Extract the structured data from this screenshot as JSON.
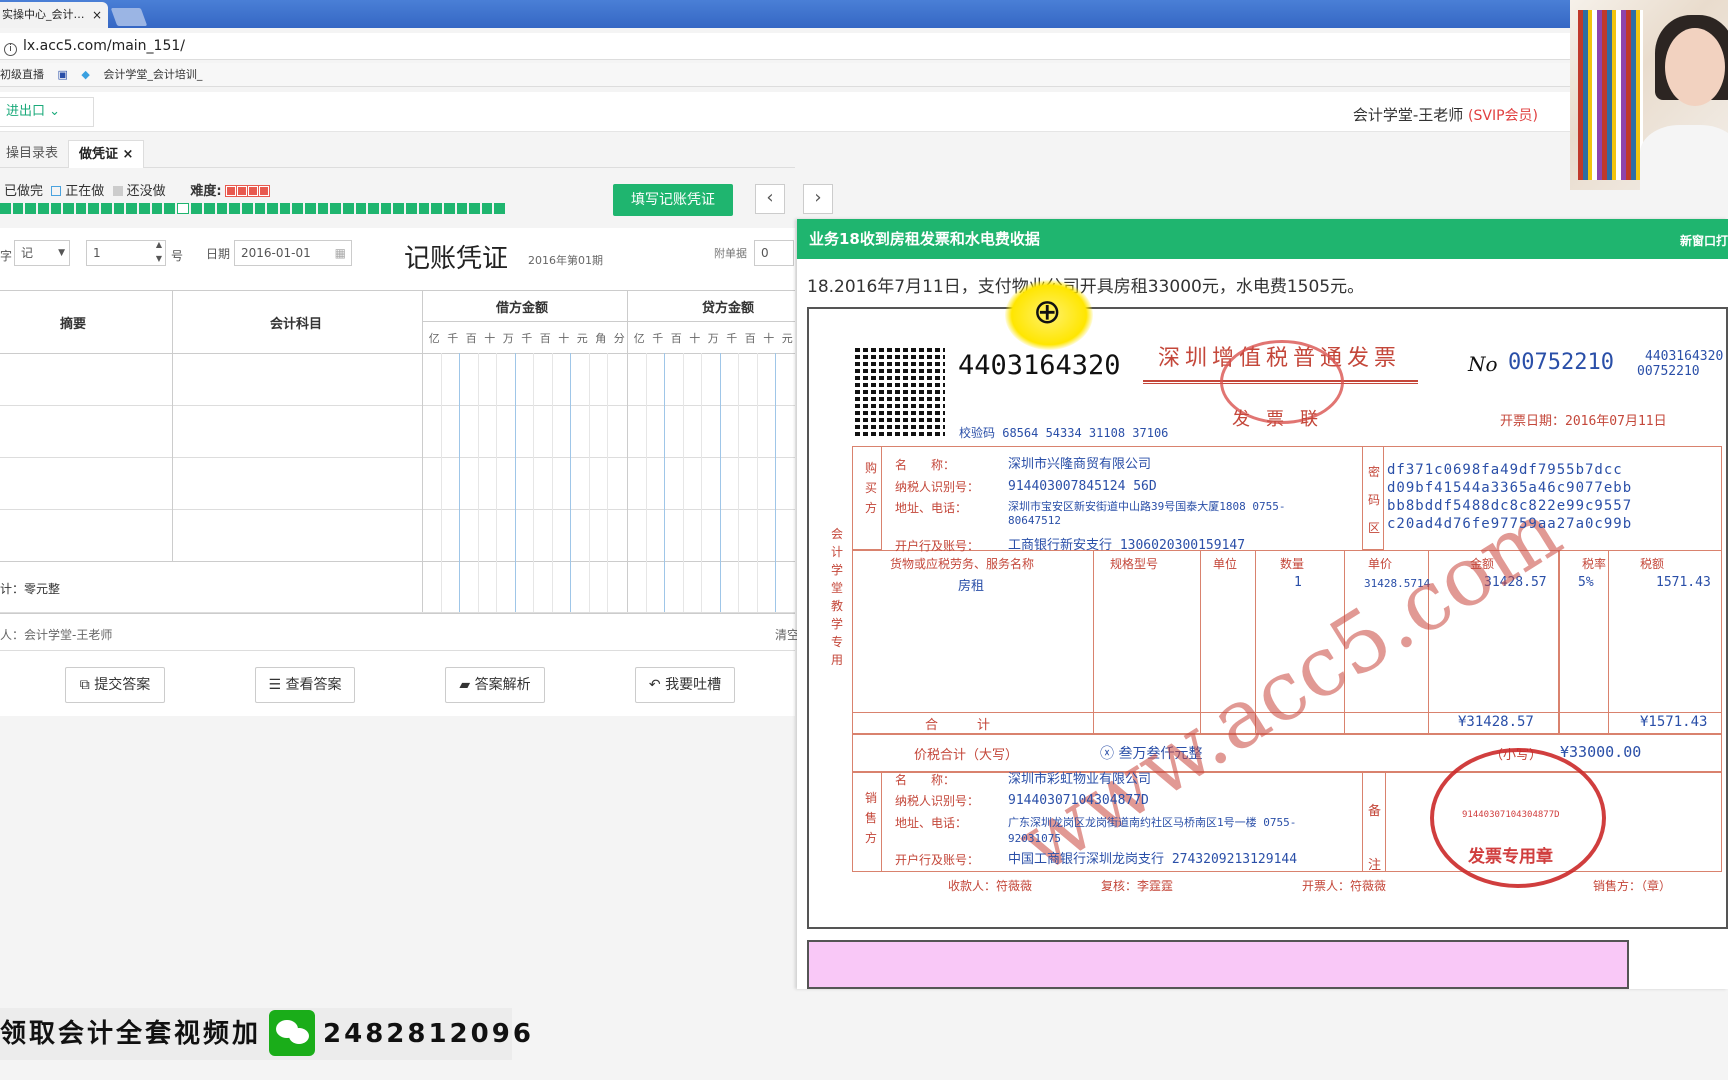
{
  "browser": {
    "tab_title": "实操中心_会计…",
    "tab_close": "×",
    "url": "lx.acc5.com/main_151/",
    "bookmarks": [
      "初级直播",
      "会计学堂_会计培训_"
    ]
  },
  "header": {
    "export_menu": "进出口",
    "user_name": "会计学堂-王老师",
    "vip": "(SVIP会员)"
  },
  "page_tabs": [
    "操目录表",
    "做凭证"
  ],
  "status": {
    "done": "已做完",
    "doing": "正在做",
    "not_done": "还没做",
    "difficulty_label": "难度:",
    "difficulty_stars": 4
  },
  "toolbar": {
    "fill_voucher": "填写记账凭证",
    "prev": "‹",
    "next": "›"
  },
  "voucher": {
    "word_label": "字",
    "word_value": "记",
    "number_value": "1",
    "number_suffix": "号",
    "date_label": "日期",
    "date_value": "2016-01-01",
    "title": "记账凭证",
    "period": "2016年第01期",
    "attach_label": "附单据",
    "attach_value": "0",
    "col_summary": "摘要",
    "col_account": "会计科目",
    "col_debit": "借方金额",
    "col_credit": "贷方金额",
    "digits": [
      "亿",
      "千",
      "百",
      "十",
      "万",
      "千",
      "百",
      "十",
      "元",
      "角",
      "分"
    ],
    "digits_credit": [
      "亿",
      "千",
      "百",
      "十",
      "万",
      "千",
      "百",
      "十",
      "元"
    ],
    "total": "计：零元整",
    "maker": "人：会计学堂-王老师",
    "clear": "清空"
  },
  "actions": {
    "submit": "提交答案",
    "view": "查看答案",
    "analysis": "答案解析",
    "feedback": "我要吐槽"
  },
  "task": {
    "heading": "业务18收到房租发票和水电费收据",
    "new_window": "新窗口打",
    "description": "18.2016年7月11日，支付物业公司开具房租33000元，水电费1505元。"
  },
  "invoice": {
    "code": "4403164320",
    "title": "深圳增值税普通发票",
    "no_prefix": "No",
    "no": "00752210",
    "code_right": "4403164320",
    "no_right": "00752210",
    "check_code": "校验码 68564 54334 31108 37106",
    "copy_type": "发票联",
    "issue_date": "开票日期：2016年07月11日",
    "buyer_side": "购买方",
    "buyer_labels": [
      "名　　称：",
      "纳税人识别号：",
      "地址、电话：",
      "开户行及账号："
    ],
    "buyer": [
      "深圳市兴隆商贸有限公司",
      "914403007845124 56D",
      "深圳市宝安区新安街道中山路39号国泰大厦1808 0755-80647512",
      "工商银行新安支行 1306020300159147"
    ],
    "cipher_label": "密码区",
    "cipher": [
      "df371c0698fa49df7955b7dcc",
      "d09bf41544a3365a46c9077ebb",
      "bb8bddf5488dc8c822e99c9557",
      "c20ad4d76fe97759aa27a0c99b"
    ],
    "side_label": "会计学堂教学专用",
    "item_headers": [
      "货物或应税劳务、服务名称",
      "规格型号",
      "单位",
      "数量",
      "单价",
      "金额",
      "税率",
      "税额"
    ],
    "item": [
      "房租",
      "",
      "",
      "1",
      "31428.5714",
      "31428.57",
      "5%",
      "1571.43"
    ],
    "sum_label": "合　　　计",
    "sum_amount": "¥31428.57",
    "sum_tax": "¥1571.43",
    "total_label": "价税合计（大写）",
    "total_words": "叁万叁仟元整",
    "total_small_label": "（小写）",
    "total_small": "¥33000.00",
    "seller_side": "销售方",
    "seller": [
      "深圳市彩虹物业有限公司",
      "91440307104304877D",
      "广东深圳龙岗区龙岗街道南约社区马桥南区1号一楼 0755-92031075",
      "中国工商银行深圳龙岗支行 2743209213129144"
    ],
    "remark_label": "备注",
    "footer": [
      "收款人：符薇薇",
      "复核：李霆霆",
      "开票人：符薇薇",
      "销售方：（章）"
    ],
    "seal_text": "发票专用章",
    "seal_id": "91440307104304877D",
    "watermark": "www.acc5.com"
  },
  "promo": {
    "text": "领取会计全套视频加",
    "number": "2482812096"
  }
}
